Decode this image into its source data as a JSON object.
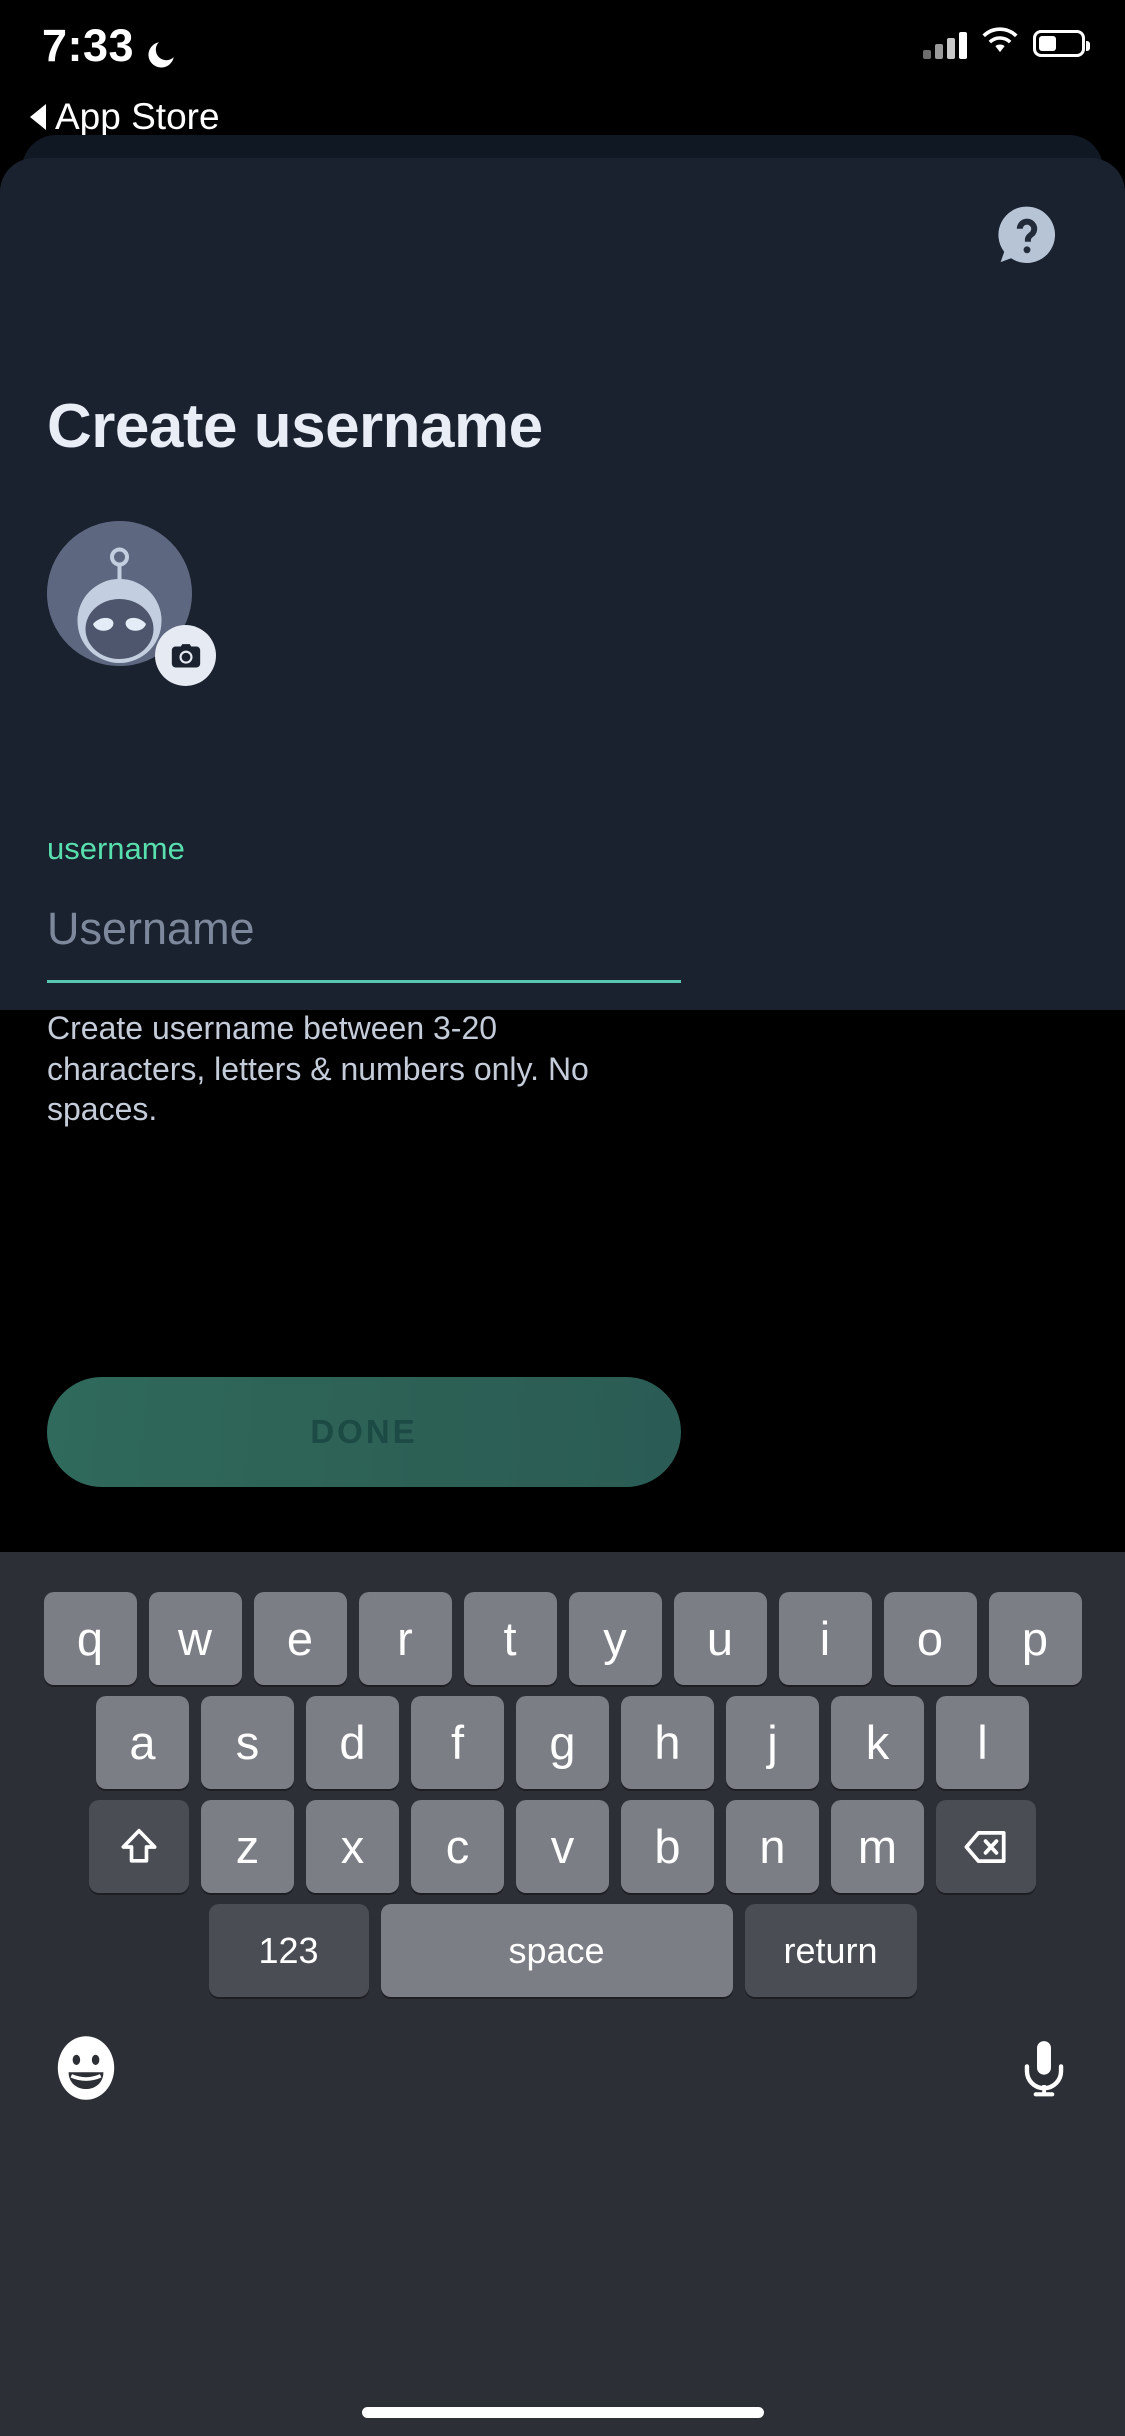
{
  "status_bar": {
    "time": "7:33",
    "dnd_icon": "moon-icon",
    "cellular_icon": "cellular-bars-icon",
    "wifi_icon": "wifi-icon",
    "battery_icon": "battery-icon",
    "battery_level_percent": 42
  },
  "back_link": {
    "label": "App Store",
    "icon": "back-arrow-icon"
  },
  "card": {
    "help_icon": "help-question-bubble-icon",
    "title": "Create username",
    "avatar": {
      "icon": "snoo-robot-avatar",
      "camera_badge_icon": "camera-icon"
    },
    "form": {
      "field_label": "username",
      "input_value": "",
      "input_placeholder": "Username",
      "helper_text": "Create username between 3-20 characters, letters & numbers only. No spaces."
    },
    "done_button": {
      "label": "DONE",
      "enabled": false
    }
  },
  "colors": {
    "background": "#000000",
    "card_front": "#1a212f",
    "card_back": "#101824",
    "accent_teal": "#58dfae",
    "underline_teal": "#58c6b0",
    "title_text": "#e9edf6",
    "helper_text": "#c4ccda",
    "placeholder": "#7e889c",
    "done_button_bg": "#2d6055",
    "done_button_text": "#1c4a45",
    "keyboard_bg": "#2c2f35",
    "key_bg": "#7b7e85",
    "key_dark_bg": "#4a4d54",
    "avatar_circle": "#5d6780"
  },
  "keyboard": {
    "row1": [
      "q",
      "w",
      "e",
      "r",
      "t",
      "y",
      "u",
      "i",
      "o",
      "p"
    ],
    "row2": [
      "a",
      "s",
      "d",
      "f",
      "g",
      "h",
      "j",
      "k",
      "l"
    ],
    "row3_letters": [
      "z",
      "x",
      "c",
      "v",
      "b",
      "n",
      "m"
    ],
    "shift_icon": "shift-arrow-icon",
    "backspace_icon": "backspace-delete-icon",
    "numbers_key": "123",
    "space_key": "space",
    "return_key": "return",
    "emoji_icon": "emoji-smiley-icon",
    "dictation_icon": "microphone-icon"
  }
}
